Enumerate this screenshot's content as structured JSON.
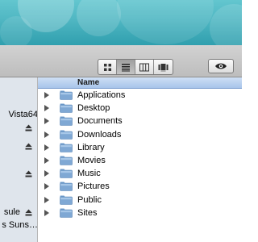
{
  "toolbar": {
    "view_modes": [
      "icon-view",
      "list-view",
      "column-view",
      "cover-flow-view"
    ],
    "active_view": "list-view",
    "quicklook_icon": "eye-icon"
  },
  "sidebar": {
    "items": [
      {
        "label": "Vista64",
        "ejectable": false
      },
      {
        "label": "",
        "ejectable": true
      },
      {
        "label": "",
        "ejectable": true
      },
      {
        "label": "",
        "ejectable": true
      },
      {
        "label": "sule",
        "ejectable": true
      },
      {
        "label": "s Suns…",
        "ejectable": false
      }
    ]
  },
  "list": {
    "header_name": "Name",
    "items": [
      {
        "name": "Applications"
      },
      {
        "name": "Desktop"
      },
      {
        "name": "Documents"
      },
      {
        "name": "Downloads"
      },
      {
        "name": "Library"
      },
      {
        "name": "Movies"
      },
      {
        "name": "Music"
      },
      {
        "name": "Pictures"
      },
      {
        "name": "Public"
      },
      {
        "name": "Sites"
      }
    ]
  },
  "colors": {
    "wallpaper": "#4fb6c2",
    "sidebar_bg": "#dfe5ec",
    "header_bg": "#a7c4ea",
    "folder": "#7fa8d4"
  }
}
